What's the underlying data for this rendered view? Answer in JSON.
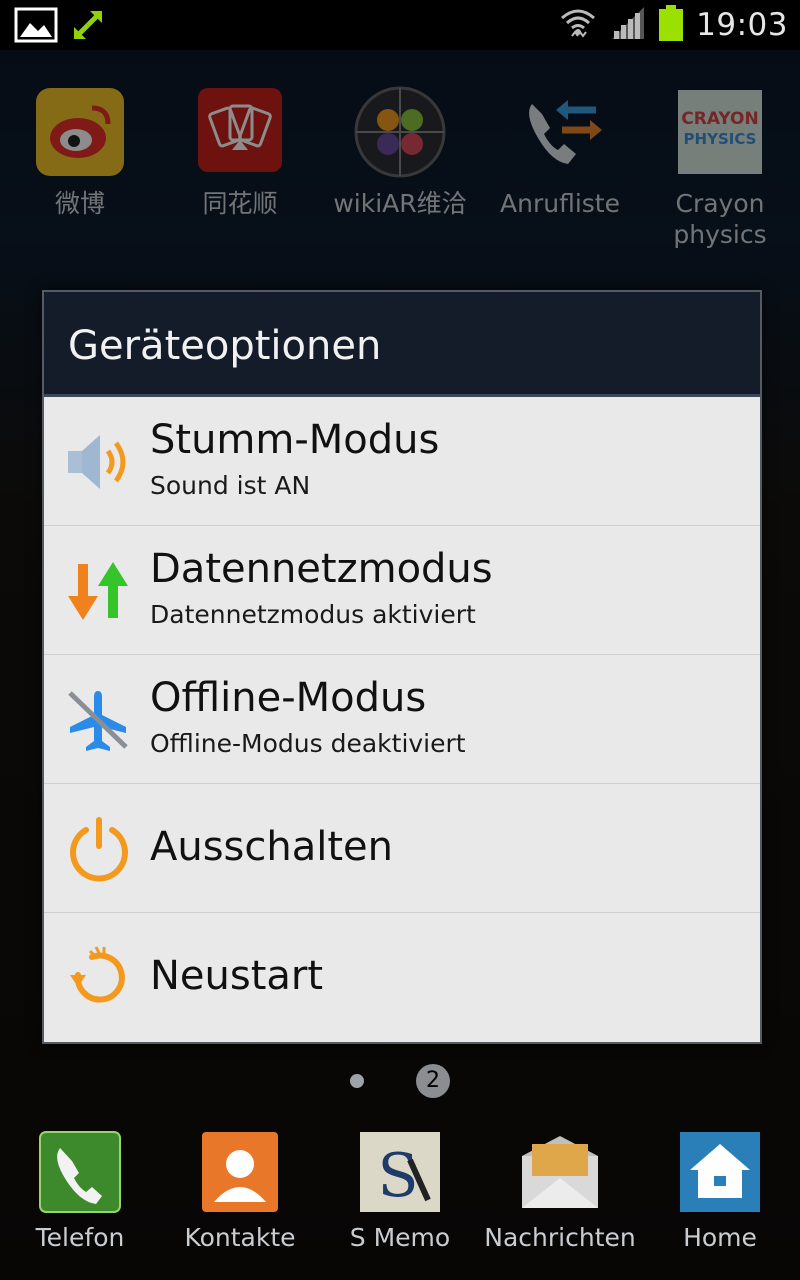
{
  "status_bar": {
    "time": "19:03",
    "icons": [
      "picture-icon",
      "sync-arrows-icon",
      "wifi-icon",
      "signal-icon",
      "battery-icon"
    ]
  },
  "home_apps_row1": [
    {
      "label": "微博",
      "icon": "weibo-icon"
    },
    {
      "label": "同花顺",
      "icon": "cards-icon"
    },
    {
      "label": "wikiAR维洽",
      "icon": "wikiar-icon"
    },
    {
      "label": "Anrufliste",
      "icon": "call-log-icon"
    },
    {
      "label": "Crayon physics",
      "icon": "crayon-physics-icon"
    }
  ],
  "dock": [
    {
      "label": "Telefon",
      "icon": "phone-icon"
    },
    {
      "label": "Kontakte",
      "icon": "contacts-icon"
    },
    {
      "label": "S Memo",
      "icon": "smemo-icon"
    },
    {
      "label": "Nachrichten",
      "icon": "messages-icon"
    },
    {
      "label": "Home",
      "icon": "home-icon"
    }
  ],
  "pager": {
    "current": "2"
  },
  "dialog": {
    "title": "Geräteoptionen",
    "options": [
      {
        "title": "Stumm-Modus",
        "subtitle": "Sound ist AN",
        "icon": "speaker-icon"
      },
      {
        "title": "Datennetzmodus",
        "subtitle": "Datennetzmodus aktiviert",
        "icon": "data-arrows-icon"
      },
      {
        "title": "Offline-Modus",
        "subtitle": "Offline-Modus deaktiviert",
        "icon": "airplane-icon"
      },
      {
        "title": "Ausschalten",
        "icon": "power-icon"
      },
      {
        "title": "Neustart",
        "icon": "restart-icon"
      }
    ]
  },
  "colors": {
    "dialog_title_bg": "#141c29",
    "dialog_bg": "#e9e9e9",
    "battery": "#9be000",
    "accent_orange": "#f39a1e",
    "accent_green": "#35c52b",
    "accent_blue": "#2a8be8"
  }
}
